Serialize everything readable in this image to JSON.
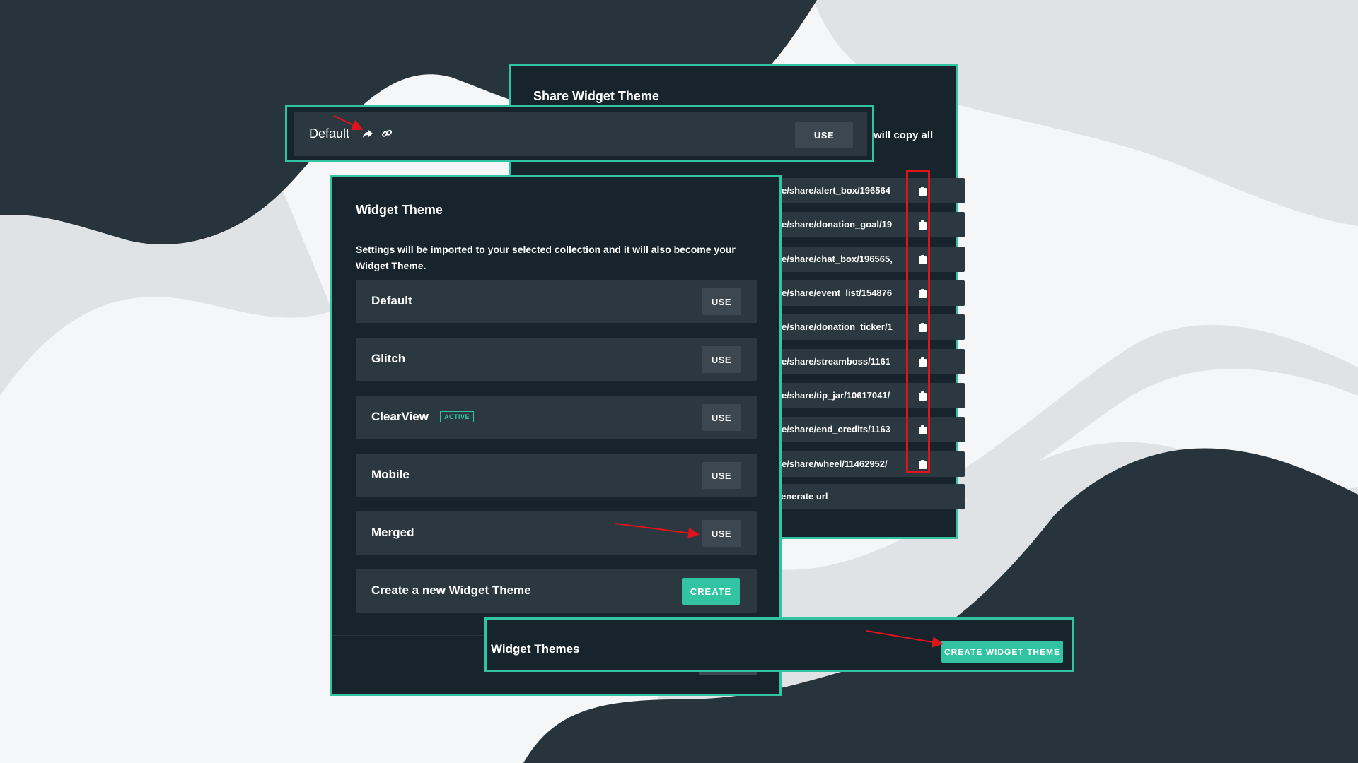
{
  "colors": {
    "accent": "#31c3a2",
    "panel_bg": "#17242c",
    "row_bg": "#2c3840",
    "button_bg": "#3c474f",
    "annotation_red": "#e0131b"
  },
  "share_panel": {
    "title": "Share Widget Theme",
    "copy_all_text": "will copy all",
    "urls": [
      "e/share/alert_box/196564",
      "e/share/donation_goal/19",
      "e/share/chat_box/196565,",
      "e/share/event_list/154876",
      "e/share/donation_ticker/1",
      "e/share/streamboss/1161",
      "e/share/tip_jar/10617041/",
      "e/share/end_credits/1163",
      "e/share/wheel/11462952/"
    ],
    "copy_icon": "clipboard-icon",
    "generate_label": "enerate url"
  },
  "default_bar": {
    "label": "Default",
    "share_icon": "share-arrow-icon",
    "link_icon": "link-icon",
    "use_label": "USE"
  },
  "theme_panel": {
    "title": "Widget Theme",
    "description": "Settings will be imported to your selected collection and it will also become your Widget Theme.",
    "themes": [
      {
        "name": "Default",
        "use_label": "USE"
      },
      {
        "name": "Glitch",
        "use_label": "USE"
      },
      {
        "name": "ClearView",
        "badge": "ACTIVE",
        "use_label": "USE"
      },
      {
        "name": "Mobile",
        "use_label": "USE"
      },
      {
        "name": "Merged",
        "use_label": "USE"
      }
    ],
    "create_row": {
      "label": "Create a new Widget Theme",
      "button": "CREATE"
    }
  },
  "themes_bar": {
    "label": "Widget Themes",
    "button": "CREATE WIDGET THEME"
  }
}
